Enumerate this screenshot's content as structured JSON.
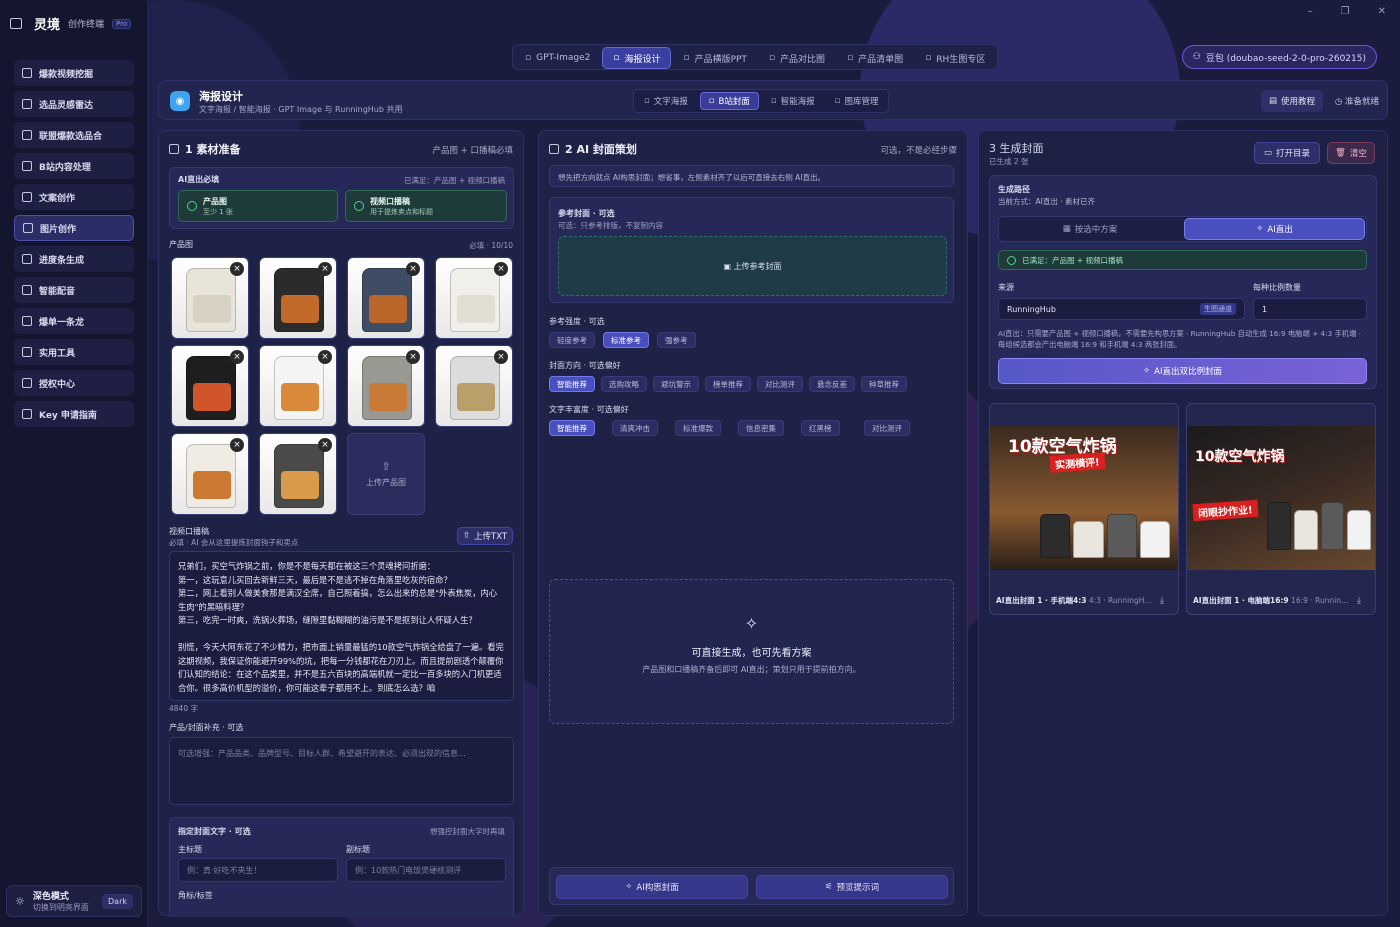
{
  "brand": {
    "name": "灵境",
    "subtitle": "创作终端",
    "badge": "Pro"
  },
  "sidebar": {
    "items": [
      {
        "label": "爆款视频挖掘",
        "icon": "trend-icon"
      },
      {
        "label": "选品灵感雷达",
        "icon": "calendar-icon"
      },
      {
        "label": "联盟爆款选品合",
        "icon": "cart-icon"
      },
      {
        "label": "B站内容处理",
        "icon": "monitor-icon"
      },
      {
        "label": "文案创作",
        "icon": "pen-icon"
      },
      {
        "label": "图片创作",
        "icon": "palette-icon"
      },
      {
        "label": "进度条生成",
        "icon": "grid-icon"
      },
      {
        "label": "智能配音",
        "icon": "mic-icon"
      },
      {
        "label": "爆单一条龙",
        "icon": "rocket-icon"
      },
      {
        "label": "实用工具",
        "icon": "wrench-icon"
      },
      {
        "label": "授权中心",
        "icon": "shield-icon"
      },
      {
        "label": "Key 申请指南",
        "icon": "key-icon"
      }
    ],
    "active_index": 5
  },
  "theme": {
    "title": "深色模式",
    "desc": "切换到明亮界面",
    "pill": "Dark"
  },
  "top_tabs": [
    "GPT-Image2",
    "海报设计",
    "产品横版PPT",
    "产品对比图",
    "产品清单图",
    "RH生图专区"
  ],
  "top_tab_active": 1,
  "model": {
    "label": "豆包 (doubao-seed-2-0-pro-260215)"
  },
  "header": {
    "title": "海报设计",
    "subtitle": "文字海报 / 智能海报 · GPT Image 与 RunningHub 共用",
    "tutorial": "使用教程",
    "ready": "准备就绪"
  },
  "sub_tabs": [
    "文字海报",
    "B站封面",
    "智能海报",
    "图库管理"
  ],
  "sub_tab_active": 1,
  "p1": {
    "title": "1 素材准备",
    "right": "产品图 + 口播稿必填",
    "req_title": "AI直出必填",
    "req_right": "已满足：产品图 + 视频口播稿",
    "req1": {
      "a": "产品图",
      "b": "至少 1 张"
    },
    "req2": {
      "a": "视频口播稿",
      "b": "用于提炼卖点和标题"
    },
    "images_label": "产品图",
    "images_count": "必填 · 10/10",
    "upload_label": "上传产品图",
    "script_label": "视频口播稿",
    "script_desc": "必填 · AI 会从这里提炼封面钩子和卖点",
    "upload_txt": "上传TXT",
    "script_text": "兄弟们，买空气炸锅之前，你是不是每天都在被这三个灵魂拷问折磨：\n第一，这玩意儿买回去新鲜三天，最后是不是逃不掉在角落里吃灰的宿命？\n第二，网上看别人做美食那是满汉全席，自己照着搞，怎么出来的总是\"外表焦炭，内心生肉\"的黑暗料理？\n第三，吃完一时爽，洗锅火葬场，缝隙里黏糊糊的油污是不是抠到让人怀疑人生？\n\n别慌，今天大阿东花了不少精力，把市面上销量最猛的10款空气炸锅全给盘了一遍。看完这期视频，我保证你能避开99%的坑，把每一分钱都花在刀刃上。而且提前剧透个颠覆你们认知的结论：在这个品类里，并不是五六百块的高端机就一定比一百多块的入门机更适合你。很多高价机型的溢价，你可能这辈子都用不上。到底怎么选？咱",
    "char_count": "4840 字",
    "extra_label": "产品/封面补充 · 可选",
    "extra_placeholder": "可选增强：产品品类、品牌型号、目标人群、希望避开的表达、必须出现的信息...",
    "cover_text_label": "指定封面文字 · 可选",
    "cover_text_right": "想强控封面大字时再填",
    "main_title_label": "主标题",
    "main_title_ph": "例：真·好吃不夹生！",
    "sub_title_label": "副标题",
    "sub_title_ph": "例：10款热门电饭煲硬核测评",
    "tag_label": "角标/标签"
  },
  "p2": {
    "title": "2 AI 封面策划",
    "right": "可选，不是必经步骤",
    "hint": "想先把方向就点 AI构思封面；想省事，左侧素材齐了以后可直接去右侧 AI直出。",
    "ref_title": "参考封面 · 可选",
    "ref_desc": "可选：只参考排版，不复制内容",
    "ref_upload": "上传参考封面",
    "strength_label": "参考强度 · 可选",
    "strength": [
      "轻度参考",
      "标准参考",
      "强参考"
    ],
    "strength_on": 1,
    "dir_label": "封面方向 · 可选偏好",
    "dirs": [
      "智能推荐",
      "选购攻略",
      "避坑警示",
      "榜单推荐",
      "对比测评",
      "悬念反差",
      "种草推荐"
    ],
    "dir_on": 0,
    "rich_label": "文字丰富度 · 可选偏好",
    "richs": [
      "智能推荐",
      "清爽冲击",
      "标准爆款",
      "信息密集",
      "红黑榜",
      "对比测评"
    ],
    "rich_on": 0,
    "empty_title": "可直接生成，也可先看方案",
    "empty_desc": "产品图和口播稿齐备后即可 AI直出；策划只用于提前拍方向。",
    "btn1": "AI构思封面",
    "btn2": "预览提示词"
  },
  "p3": {
    "title": "3 生成封面",
    "sub": "已生成 2 张",
    "open": "打开目录",
    "clear": "清空",
    "path_title": "生成路径",
    "path_desc": "当前方式：AI直出 · 素材已齐",
    "opt1": "按选中方案",
    "opt2": "AI直出",
    "ok": "已满足：产品图 + 视频口播稿",
    "source_label": "来源",
    "source_value": "RunningHub",
    "source_badge": "生图通道",
    "count_label": "每种比例数量",
    "count_value": "1",
    "note": "AI直出：只需要产品图 + 视频口播稿，不需要先构思方案 · RunningHub 自动生成 16:9 电脑端 + 4:3 手机端 · 每组候选都会产出电脑端 16:9 和手机端 4:3 两张封面。",
    "gen_btn": "AI直出双比例封面",
    "results": [
      {
        "caption": "AI直出封面 1 · 手机端4:3",
        "meta": "4:3 · RunningH...",
        "headline": "10款空气炸锅",
        "tagline": "实测横评!"
      },
      {
        "caption": "AI直出封面 1 · 电脑端16:9",
        "meta": "16:9 · Runnin...",
        "headline": "10款空气炸锅",
        "tagline": "闭眼抄作业!"
      }
    ]
  }
}
